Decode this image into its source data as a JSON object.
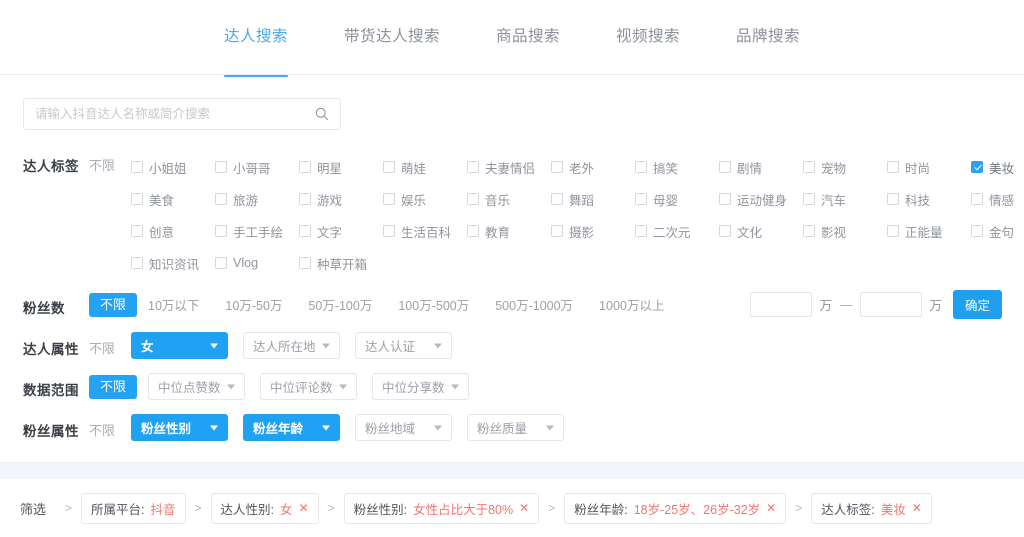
{
  "tabs": [
    {
      "label": "达人搜索",
      "active": true
    },
    {
      "label": "带货达人搜索",
      "active": false
    },
    {
      "label": "商品搜索",
      "active": false
    },
    {
      "label": "视频搜索",
      "active": false
    },
    {
      "label": "品牌搜索",
      "active": false
    }
  ],
  "search": {
    "placeholder": "请输入抖音达人名称或简介搜索",
    "value": ""
  },
  "tag_filter": {
    "label": "达人标签",
    "unlimited": "不限",
    "items": [
      {
        "label": "小姐姐",
        "checked": false
      },
      {
        "label": "小哥哥",
        "checked": false
      },
      {
        "label": "明星",
        "checked": false
      },
      {
        "label": "萌娃",
        "checked": false
      },
      {
        "label": "夫妻情侣",
        "checked": false
      },
      {
        "label": "老外",
        "checked": false
      },
      {
        "label": "搞笑",
        "checked": false
      },
      {
        "label": "剧情",
        "checked": false
      },
      {
        "label": "宠物",
        "checked": false
      },
      {
        "label": "时尚",
        "checked": false
      },
      {
        "label": "美妆",
        "checked": true
      },
      {
        "label": "美食",
        "checked": false
      },
      {
        "label": "旅游",
        "checked": false
      },
      {
        "label": "游戏",
        "checked": false
      },
      {
        "label": "娱乐",
        "checked": false
      },
      {
        "label": "音乐",
        "checked": false
      },
      {
        "label": "舞蹈",
        "checked": false
      },
      {
        "label": "母婴",
        "checked": false
      },
      {
        "label": "运动健身",
        "checked": false
      },
      {
        "label": "汽车",
        "checked": false
      },
      {
        "label": "科技",
        "checked": false
      },
      {
        "label": "情感",
        "checked": false
      },
      {
        "label": "创意",
        "checked": false
      },
      {
        "label": "手工手绘",
        "checked": false
      },
      {
        "label": "文字",
        "checked": false
      },
      {
        "label": "生活百科",
        "checked": false
      },
      {
        "label": "教育",
        "checked": false
      },
      {
        "label": "摄影",
        "checked": false
      },
      {
        "label": "二次元",
        "checked": false
      },
      {
        "label": "文化",
        "checked": false
      },
      {
        "label": "影视",
        "checked": false
      },
      {
        "label": "正能量",
        "checked": false
      },
      {
        "label": "金句",
        "checked": false
      },
      {
        "label": "知识资讯",
        "checked": false
      },
      {
        "label": "Vlog",
        "checked": false
      },
      {
        "label": "种草开箱",
        "checked": false
      }
    ]
  },
  "fans_count": {
    "label": "粉丝数",
    "unlimited": "不限",
    "unlimited_active": true,
    "options": [
      "10万以下",
      "10万-50万",
      "50万-100万",
      "100万-500万",
      "500万-1000万",
      "1000万以上"
    ],
    "range": {
      "min_value": "",
      "max_value": "",
      "min_placeholder": "",
      "max_placeholder": "",
      "unit": "万",
      "separator": "—",
      "confirm_label": "确定"
    }
  },
  "creator_attrs": {
    "label": "达人属性",
    "unlimited": "不限",
    "unlimited_active": false,
    "dropdowns": [
      {
        "label": "女",
        "active": true
      },
      {
        "label": "达人所在地",
        "active": false
      },
      {
        "label": "达人认证",
        "active": false
      }
    ]
  },
  "data_range": {
    "label": "数据范围",
    "unlimited": "不限",
    "unlimited_active": true,
    "dropdowns": [
      {
        "label": "中位点赞数",
        "active": false
      },
      {
        "label": "中位评论数",
        "active": false
      },
      {
        "label": "中位分享数",
        "active": false
      }
    ]
  },
  "fans_attrs": {
    "label": "粉丝属性",
    "unlimited": "不限",
    "unlimited_active": false,
    "dropdowns": [
      {
        "label": "粉丝性别",
        "active": true
      },
      {
        "label": "粉丝年龄",
        "active": true
      },
      {
        "label": "粉丝地域",
        "active": false
      },
      {
        "label": "粉丝质量",
        "active": false
      }
    ]
  },
  "breadcrumb": {
    "label": "筛选",
    "separator": ">",
    "chips": [
      {
        "key": "所属平台:",
        "value": "抖音",
        "closable": false
      },
      {
        "key": "达人性别:",
        "value": "女",
        "closable": true
      },
      {
        "key": "粉丝性别:",
        "value": "女性占比大于80%",
        "closable": true
      },
      {
        "key": "粉丝年龄:",
        "value": "18岁-25岁、26岁-32岁",
        "closable": true
      },
      {
        "key": "达人标签:",
        "value": "美妆",
        "closable": true
      }
    ],
    "close_glyph": "✕"
  },
  "colors": {
    "accent": "#1fa2f3",
    "tab_active": "#4fa9e8",
    "chip_value": "#f2756e",
    "band": "#f3f5fb"
  }
}
